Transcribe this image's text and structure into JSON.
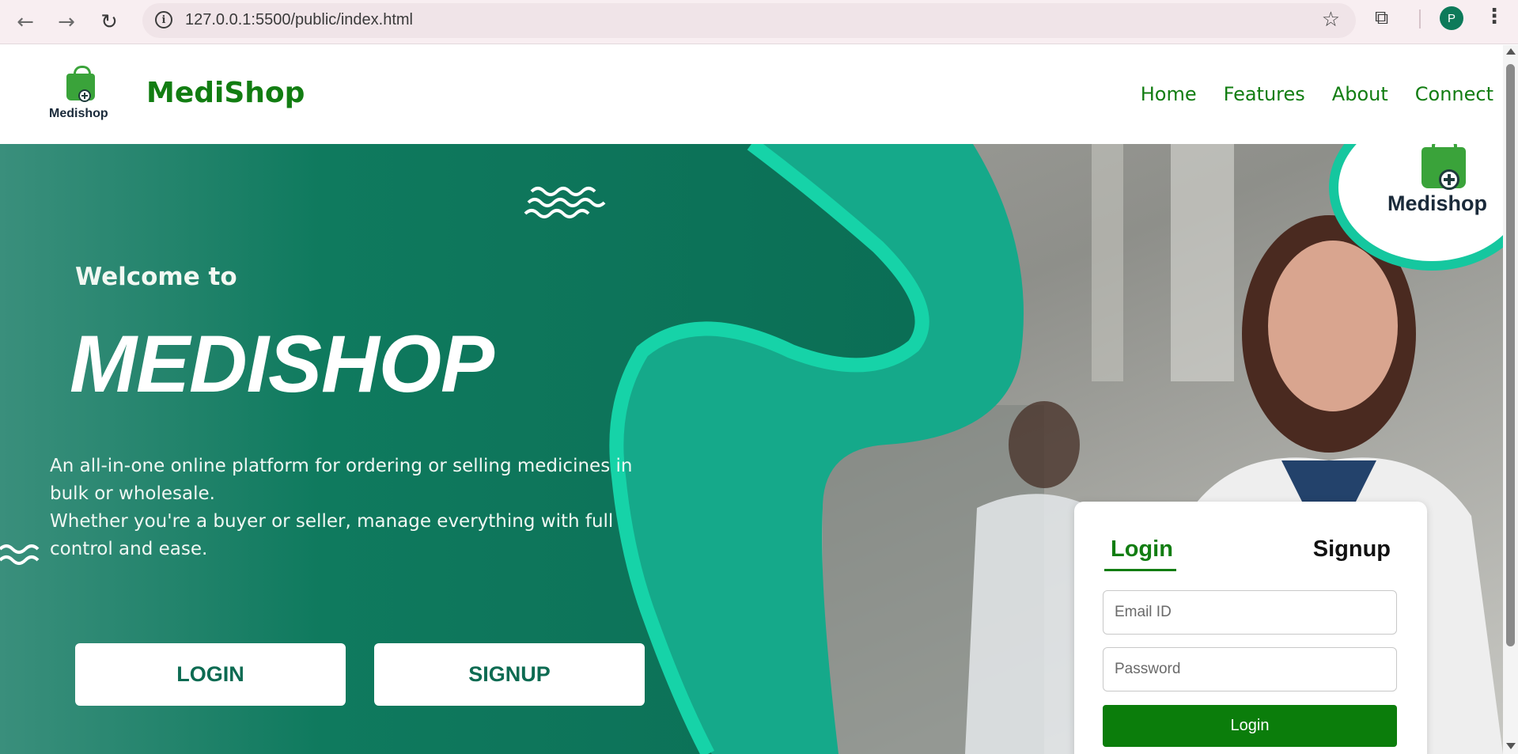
{
  "browser": {
    "url": "127.0.0.1:5500/public/index.html",
    "profile_initial": "P",
    "back_icon": "arrow-left-icon",
    "forward_icon": "arrow-right-icon",
    "reload_icon": "reload-icon"
  },
  "header": {
    "logo_caption": "Medishop",
    "brand": "MediShop",
    "nav": [
      "Home",
      "Features",
      "About",
      "Connect"
    ]
  },
  "hero": {
    "welcome": "Welcome to",
    "title": "MEDISHOP",
    "description": "An all-in-one online platform for ordering or selling medicines in bulk or wholesale.\n Whether you're a buyer or seller, manage everything with full control and ease.",
    "login_button": "LOGIN",
    "signup_button": "SIGNUP",
    "badge_caption": "Medishop"
  },
  "auth": {
    "tab_login": "Login",
    "tab_signup": "Signup",
    "email_placeholder": "Email ID",
    "password_placeholder": "Password",
    "submit": "Login"
  },
  "colors": {
    "brand_green": "#127d12",
    "hero_teal": "#0d7a5a",
    "accent_teal": "#15c79f",
    "button_green": "#0b7d0b"
  }
}
